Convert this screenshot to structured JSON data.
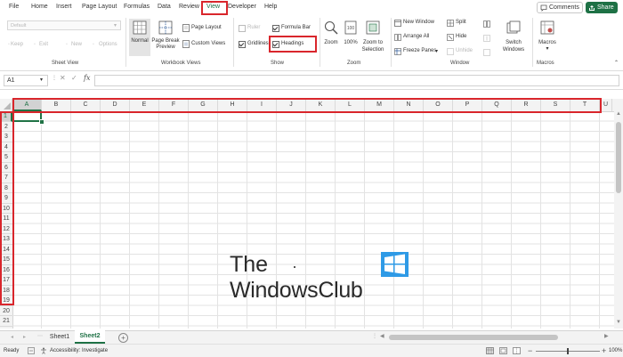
{
  "menu": {
    "tabs": [
      "File",
      "Home",
      "Insert",
      "Page Layout",
      "Formulas",
      "Data",
      "Review",
      "View",
      "Developer",
      "Help"
    ],
    "active": "View",
    "comments_label": "Comments",
    "share_label": "Share"
  },
  "ribbon": {
    "sheet_view": {
      "dropdown_value": "Default",
      "keep": "Keep",
      "exit": "Exit",
      "new": "New",
      "options": "Options",
      "label": "Sheet View"
    },
    "workbook_views": {
      "normal": "Normal",
      "page_break_1": "Page Break",
      "page_break_2": "Preview",
      "page_layout": "Page Layout",
      "custom_views": "Custom Views",
      "label": "Workbook Views"
    },
    "show": {
      "ruler": "Ruler",
      "formula_bar": "Formula Bar",
      "gridlines": "Gridlines",
      "headings": "Headings",
      "label": "Show"
    },
    "zoom": {
      "zoom": "Zoom",
      "hundred": "100%",
      "zoom_sel_1": "Zoom to",
      "zoom_sel_2": "Selection",
      "label": "Zoom"
    },
    "window": {
      "new_window": "New Window",
      "arrange_all": "Arrange All",
      "freeze_panes": "Freeze Panes",
      "split": "Split",
      "hide": "Hide",
      "unhide": "Unhide",
      "switch_1": "Switch",
      "switch_2": "Windows",
      "label": "Window"
    },
    "macros": {
      "macros": "Macros",
      "label": "Macros"
    }
  },
  "formula_bar": {
    "name_box": "A1",
    "fx": "fx",
    "formula": ""
  },
  "grid": {
    "columns": [
      "A",
      "B",
      "C",
      "D",
      "E",
      "F",
      "G",
      "H",
      "I",
      "J",
      "K",
      "L",
      "M",
      "N",
      "O",
      "P",
      "Q",
      "R",
      "S",
      "T",
      "U"
    ],
    "rows": [
      "1",
      "2",
      "3",
      "4",
      "5",
      "6",
      "7",
      "8",
      "9",
      "10",
      "11",
      "12",
      "13",
      "14",
      "15",
      "16",
      "17",
      "18",
      "19",
      "20",
      "21"
    ]
  },
  "watermark": {
    "line1": "The",
    "line2": "WindowsClub"
  },
  "sheets": {
    "tabs": [
      "Sheet1",
      "Sheet2"
    ],
    "active": "Sheet2"
  },
  "status": {
    "ready": "Ready",
    "accessibility": "Accessibility: Investigate",
    "zoom": "100%"
  },
  "colors": {
    "accent_green": "#1e7145",
    "highlight_red": "#d9262c",
    "selection_green": "#217346"
  }
}
